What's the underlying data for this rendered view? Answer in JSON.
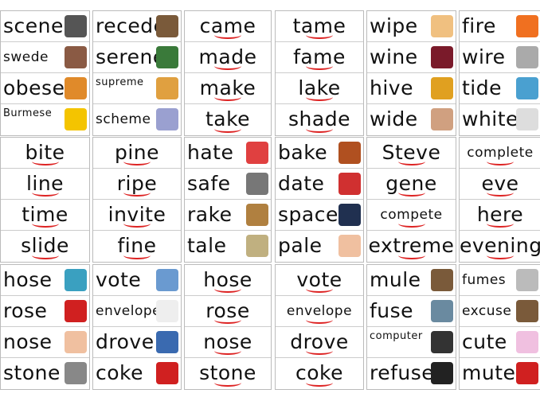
{
  "blocks": [
    {
      "columns": [
        [
          {
            "w": "scene",
            "pic": "clapperboard-icon",
            "c": "#555"
          },
          {
            "w": "swede",
            "pic": "swede-icon",
            "c": "#8a5a44",
            "s": 1
          },
          {
            "w": "obese",
            "pic": "person-icon",
            "c": "#e08a2a"
          },
          {
            "w": "Burmese",
            "pic": "myanmar-flag-icon",
            "c": "#f4c400",
            "t": 1
          }
        ],
        [
          {
            "w": "recede",
            "pic": "receding-hair-icon",
            "c": "#7a5a3a"
          },
          {
            "w": "serene",
            "pic": "landscape-icon",
            "c": "#3a7a3a"
          },
          {
            "w": "supreme",
            "pic": "pizza-icon",
            "c": "#e0a040",
            "t": 1
          },
          {
            "w": "scheme",
            "pic": "clipboard-icon",
            "c": "#9aa0d0",
            "s": 1
          }
        ],
        [
          {
            "w": "came",
            "m": 1
          },
          {
            "w": "made",
            "m": 1
          },
          {
            "w": "make",
            "m": 1
          },
          {
            "w": "take",
            "m": 1
          }
        ],
        [
          {
            "w": "tame",
            "m": 1
          },
          {
            "w": "fame",
            "m": 1
          },
          {
            "w": "lake",
            "m": 1
          },
          {
            "w": "shade",
            "m": 1
          }
        ],
        [
          {
            "w": "wipe",
            "pic": "wipe-face-icon",
            "c": "#f0c080"
          },
          {
            "w": "wine",
            "pic": "wine-icon",
            "c": "#7a1a2a"
          },
          {
            "w": "hive",
            "pic": "beehive-icon",
            "c": "#e0a020"
          },
          {
            "w": "wide",
            "pic": "people-icon",
            "c": "#d0a080"
          }
        ],
        [
          {
            "w": "fire",
            "pic": "fire-icon",
            "c": "#f07020"
          },
          {
            "w": "wire",
            "pic": "wire-icon",
            "c": "#aaa"
          },
          {
            "w": "tide",
            "pic": "sea-icon",
            "c": "#4aa0d0"
          },
          {
            "w": "white",
            "pic": "cloud-icon",
            "c": "#ddd"
          }
        ]
      ]
    },
    {
      "columns": [
        [
          {
            "w": "bite",
            "m": 1
          },
          {
            "w": "line",
            "m": 1
          },
          {
            "w": "time",
            "m": 1
          },
          {
            "w": "slide",
            "m": 1
          }
        ],
        [
          {
            "w": "pine",
            "m": 1
          },
          {
            "w": "ripe",
            "m": 1
          },
          {
            "w": "invite",
            "m": 1
          },
          {
            "w": "fine",
            "m": 1
          }
        ],
        [
          {
            "w": "hate",
            "pic": "no-sign-icon",
            "c": "#e04040"
          },
          {
            "w": "safe",
            "pic": "safe-icon",
            "c": "#777"
          },
          {
            "w": "rake",
            "pic": "rake-icon",
            "c": "#b08040"
          },
          {
            "w": "tale",
            "pic": "book-icon",
            "c": "#c0b080"
          }
        ],
        [
          {
            "w": "bake",
            "pic": "oven-icon",
            "c": "#b05020"
          },
          {
            "w": "date",
            "pic": "calendar-icon",
            "c": "#d03030"
          },
          {
            "w": "space",
            "pic": "rocket-icon",
            "c": "#203050"
          },
          {
            "w": "pale",
            "pic": "hand-icon",
            "c": "#f0c0a0"
          }
        ],
        [
          {
            "w": "Steve",
            "m": 1
          },
          {
            "w": "gene",
            "m": 1
          },
          {
            "w": "compete",
            "m": 1,
            "s": 1
          },
          {
            "w": "extreme",
            "m": 1
          }
        ],
        [
          {
            "w": "complete",
            "m": 1,
            "s": 1
          },
          {
            "w": "eve",
            "m": 1
          },
          {
            "w": "here",
            "m": 1
          },
          {
            "w": "evening",
            "m": 1
          }
        ]
      ]
    },
    {
      "columns": [
        [
          {
            "w": "hose",
            "pic": "hose-icon",
            "c": "#3aa0c0"
          },
          {
            "w": "rose",
            "pic": "rose-icon",
            "c": "#d02020"
          },
          {
            "w": "nose",
            "pic": "nose-icon",
            "c": "#f0c0a0"
          },
          {
            "w": "stone",
            "pic": "stone-icon",
            "c": "#888"
          }
        ],
        [
          {
            "w": "vote",
            "pic": "ballot-box-icon",
            "c": "#6a9ad0"
          },
          {
            "w": "envelope",
            "pic": "envelope-icon",
            "c": "#eee",
            "s": 1
          },
          {
            "w": "drove",
            "pic": "driver-icon",
            "c": "#3a6ab0"
          },
          {
            "w": "coke",
            "pic": "can-icon",
            "c": "#d02020"
          }
        ],
        [
          {
            "w": "hose",
            "m": 1
          },
          {
            "w": "rose",
            "m": 1
          },
          {
            "w": "nose",
            "m": 1
          },
          {
            "w": "stone",
            "m": 1
          }
        ],
        [
          {
            "w": "vote",
            "m": 1
          },
          {
            "w": "envelope",
            "m": 1,
            "s": 1
          },
          {
            "w": "drove",
            "m": 1
          },
          {
            "w": "coke",
            "m": 1
          }
        ],
        [
          {
            "w": "mule",
            "pic": "mule-icon",
            "c": "#7a5a3a"
          },
          {
            "w": "fuse",
            "pic": "fuse-box-icon",
            "c": "#6a8aa0"
          },
          {
            "w": "computer",
            "pic": "laptop-icon",
            "c": "#333",
            "t": 1
          },
          {
            "w": "refuse",
            "pic": "bin-icon",
            "c": "#222"
          }
        ],
        [
          {
            "w": "fumes",
            "pic": "factory-icon",
            "c": "#bbb",
            "s": 1
          },
          {
            "w": "excuse",
            "pic": "shrug-person-icon",
            "c": "#7a5a3a",
            "s": 1
          },
          {
            "w": "cute",
            "pic": "unicorn-icon",
            "c": "#f0c0e0"
          },
          {
            "w": "mute",
            "pic": "mute-icon",
            "c": "#d02020"
          }
        ]
      ]
    }
  ]
}
